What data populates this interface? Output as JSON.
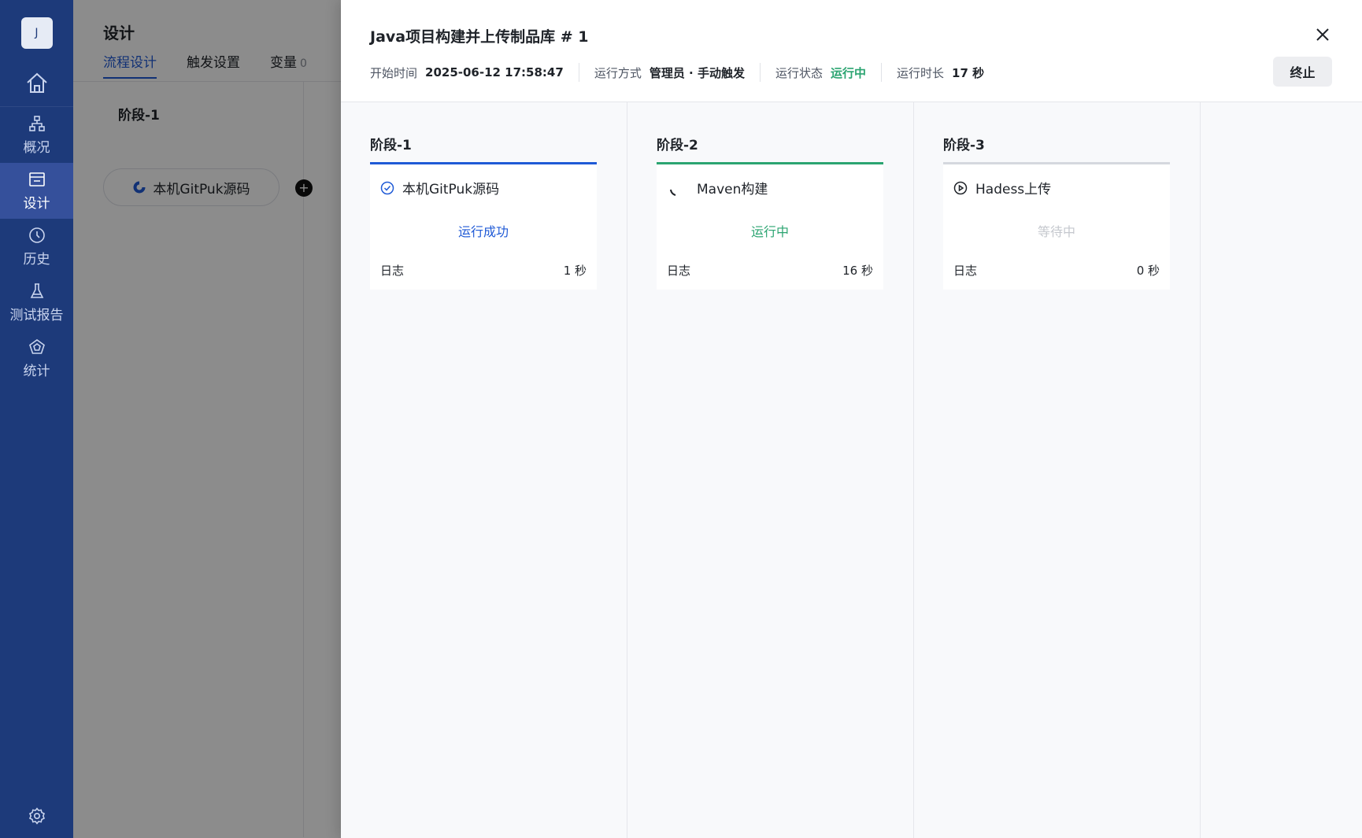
{
  "sidebar": {
    "avatar": "J",
    "items": [
      {
        "label": "概况"
      },
      {
        "label": "设计"
      },
      {
        "label": "历史"
      },
      {
        "label": "测试报告"
      },
      {
        "label": "统计"
      }
    ]
  },
  "design": {
    "title": "设计",
    "tabs": [
      {
        "label": "流程设计"
      },
      {
        "label": "触发设置"
      },
      {
        "label": "变量",
        "count": "0"
      }
    ],
    "stage_title": "阶段-1",
    "task_label": "本机GitPuk源码",
    "add_label": "+"
  },
  "drawer": {
    "title": "Java项目构建并上传制品库 # 1",
    "meta": {
      "start_label": "开始时间",
      "start_value": "2025-06-12 17:58:47",
      "mode_label": "运行方式",
      "mode_value": "管理员 · 手动触发",
      "state_label": "运行状态",
      "state_value": "运行中",
      "duration_label": "运行时长",
      "duration_value": "17 秒"
    },
    "stop_label": "终止",
    "stages": [
      {
        "name": "阶段-1",
        "task": "本机GitPuk源码",
        "status": "运行成功",
        "log": "日志",
        "time": "1 秒"
      },
      {
        "name": "阶段-2",
        "task": "Maven构建",
        "status": "运行中",
        "log": "日志",
        "time": "16 秒"
      },
      {
        "name": "阶段-3",
        "task": "Hadess上传",
        "status": "等待中",
        "log": "日志",
        "time": "0 秒"
      }
    ]
  },
  "colors": {
    "sidebar": "#1d3a7a",
    "primary": "#1f5ad6",
    "success": "#2ba471",
    "pending": "#c5c8ce"
  }
}
